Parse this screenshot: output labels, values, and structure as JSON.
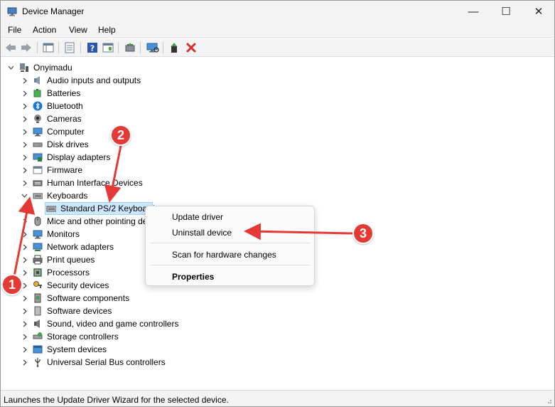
{
  "window": {
    "title": "Device Manager",
    "controls": {
      "minimize": "—",
      "maximize": "☐",
      "close": "✕"
    }
  },
  "menu": {
    "items": [
      "File",
      "Action",
      "View",
      "Help"
    ]
  },
  "tree": {
    "root": "Onyimadu",
    "categories": [
      "Audio inputs and outputs",
      "Batteries",
      "Bluetooth",
      "Cameras",
      "Computer",
      "Disk drives",
      "Display adapters",
      "Firmware",
      "Human Interface Devices",
      "Keyboards",
      "Mice and other pointing devices",
      "Monitors",
      "Network adapters",
      "Print queues",
      "Processors",
      "Security devices",
      "Software components",
      "Software devices",
      "Sound, video and game controllers",
      "Storage controllers",
      "System devices",
      "Universal Serial Bus controllers"
    ],
    "keyboard_child": "Standard PS/2 Keyboard"
  },
  "context_menu": {
    "update_driver": "Update driver",
    "uninstall_device": "Uninstall device",
    "scan_hardware": "Scan for hardware changes",
    "properties": "Properties"
  },
  "status": {
    "text": "Launches the Update Driver Wizard for the selected device."
  },
  "annotations": {
    "one": "1",
    "two": "2",
    "three": "3"
  },
  "colors": {
    "accent_red": "#e53935",
    "selection": "#cce8ff"
  }
}
